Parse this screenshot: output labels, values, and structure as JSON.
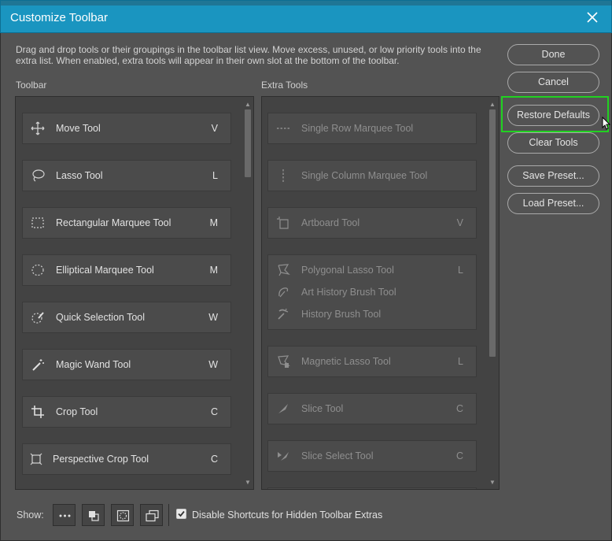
{
  "window": {
    "title": "Customize Toolbar"
  },
  "instructions": "Drag and drop tools or their groupings in the toolbar list view. Move excess, unused, or low priority tools into the extra list. When enabled, extra tools will appear in their own slot at the bottom of the toolbar.",
  "toolbar_label": "Toolbar",
  "extra_label": "Extra Tools",
  "toolbar_tools": [
    {
      "name": "Move Tool",
      "key": "V",
      "icon": "move-icon"
    },
    {
      "name": "Lasso Tool",
      "key": "L",
      "icon": "lasso-icon"
    },
    {
      "name": "Rectangular Marquee Tool",
      "key": "M",
      "icon": "rectangular-marquee-icon"
    },
    {
      "name": "Elliptical Marquee Tool",
      "key": "M",
      "icon": "elliptical-marquee-icon"
    },
    {
      "name": "Quick Selection Tool",
      "key": "W",
      "icon": "quick-selection-icon"
    },
    {
      "name": "Magic Wand Tool",
      "key": "W",
      "icon": "magic-wand-icon"
    },
    {
      "name": "Crop Tool",
      "key": "C",
      "icon": "crop-icon"
    },
    {
      "name": "Perspective Crop Tool",
      "key": "C",
      "icon": "perspective-crop-icon"
    }
  ],
  "extra_tools": [
    {
      "name": "Single Row Marquee Tool",
      "key": "",
      "icon": "single-row-marquee-icon"
    },
    {
      "name": "Single Column Marquee Tool",
      "key": "",
      "icon": "single-column-marquee-icon"
    },
    {
      "name": "Artboard Tool",
      "key": "V",
      "icon": "artboard-icon"
    },
    {
      "name": "Polygonal Lasso Tool",
      "key": "L",
      "icon": "polygonal-lasso-icon"
    },
    {
      "name": "Art History Brush Tool",
      "key": "",
      "icon": "art-history-brush-icon"
    },
    {
      "name": "History Brush Tool",
      "key": "",
      "icon": "history-brush-icon"
    },
    {
      "name": "Magnetic Lasso Tool",
      "key": "L",
      "icon": "magnetic-lasso-icon"
    },
    {
      "name": "Slice Tool",
      "key": "C",
      "icon": "slice-icon"
    },
    {
      "name": "Slice Select Tool",
      "key": "C",
      "icon": "slice-select-icon"
    }
  ],
  "buttons": {
    "done": "Done",
    "cancel": "Cancel",
    "restore": "Restore Defaults",
    "clear": "Clear Tools",
    "save_preset": "Save Preset...",
    "load_preset": "Load Preset..."
  },
  "footer": {
    "show_label": "Show:",
    "checkbox_label": "Disable Shortcuts for Hidden Toolbar Extras",
    "checkbox_checked": true
  },
  "colors": {
    "title_bar": "#1a95c0",
    "highlight": "#21d121",
    "dialog_bg": "#535353"
  }
}
